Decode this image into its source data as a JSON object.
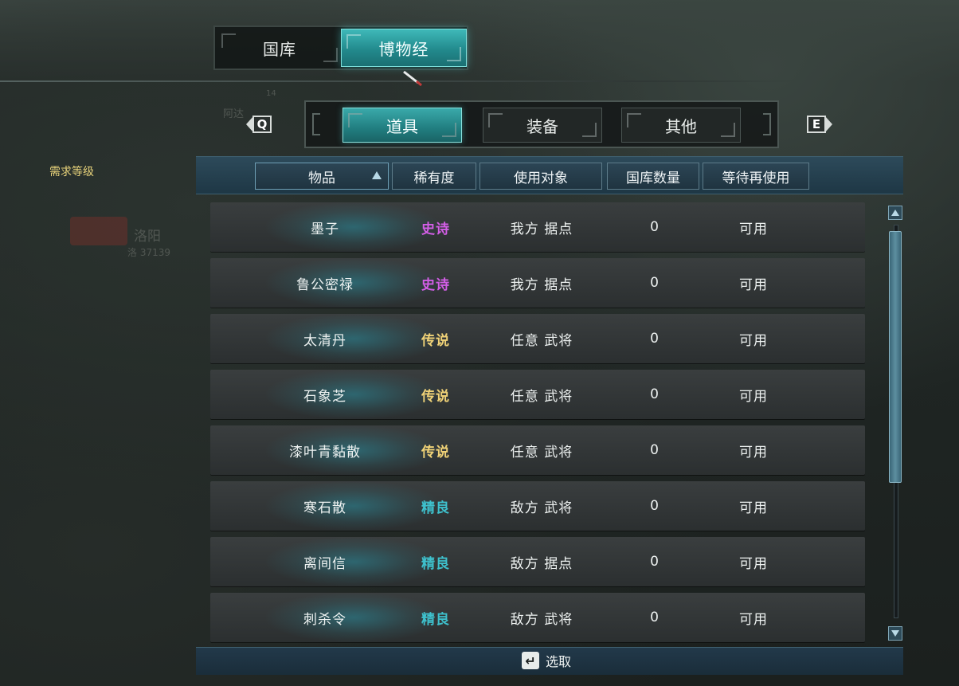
{
  "main_tabs": [
    {
      "label": "国库",
      "active": false
    },
    {
      "label": "博物经",
      "active": true
    }
  ],
  "sub_tabs": [
    {
      "label": "道具",
      "active": true
    },
    {
      "label": "装备",
      "active": false
    },
    {
      "label": "其他",
      "active": false
    }
  ],
  "keys": {
    "prev": "Q",
    "next": "E"
  },
  "sidebar": {
    "filter_label": "需求等级"
  },
  "table": {
    "headers": [
      "物品",
      "稀有度",
      "使用对象",
      "国库数量",
      "等待再使用"
    ],
    "sorted_column": "物品",
    "rows": [
      {
        "name": "墨子",
        "rarity": "史诗",
        "target": "我方 据点",
        "count": "0",
        "status": "可用"
      },
      {
        "name": "鲁公密禄",
        "rarity": "史诗",
        "target": "我方 据点",
        "count": "0",
        "status": "可用"
      },
      {
        "name": "太清丹",
        "rarity": "传说",
        "target": "任意 武将",
        "count": "0",
        "status": "可用"
      },
      {
        "name": "石象芝",
        "rarity": "传说",
        "target": "任意 武将",
        "count": "0",
        "status": "可用"
      },
      {
        "name": "漆叶青黏散",
        "rarity": "传说",
        "target": "任意 武将",
        "count": "0",
        "status": "可用"
      },
      {
        "name": "寒石散",
        "rarity": "精良",
        "target": "敌方 武将",
        "count": "0",
        "status": "可用"
      },
      {
        "name": "离间信",
        "rarity": "精良",
        "target": "敌方 据点",
        "count": "0",
        "status": "可用"
      },
      {
        "name": "刺杀令",
        "rarity": "精良",
        "target": "敌方 武将",
        "count": "0",
        "status": "可用"
      }
    ]
  },
  "rarity_colors": {
    "史诗": "#d35ee6",
    "传说": "#f0d277",
    "精良": "#3ec0cc"
  },
  "footer": {
    "select_label": "选取",
    "select_icon": "enter-key-icon"
  },
  "map_background": {
    "city_label": "洛阳",
    "city_sub": "洛 37139",
    "marker": "14",
    "town": "阿达"
  }
}
